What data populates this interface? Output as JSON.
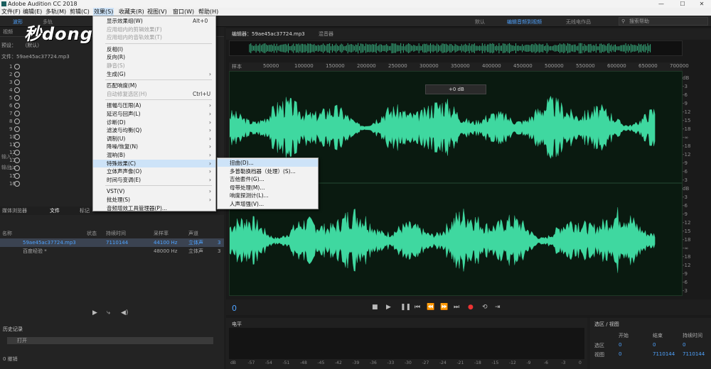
{
  "window": {
    "title": "Adobe Audition CC 2018"
  },
  "menus": {
    "file": "文件(F)",
    "edit": "编辑(E)",
    "multitrack": "多轨(M)",
    "clip": "剪辑(C)",
    "effects": "效果(S)",
    "favorites": "收藏夹(R)",
    "view": "视图(V)",
    "window": "窗口(W)",
    "help": "帮助(H)"
  },
  "workspaces": {
    "default": "默认",
    "edit_audio": "编辑音频到视频",
    "radio": "无线电作品"
  },
  "search": {
    "placeholder": "搜索帮助"
  },
  "logo": {
    "text": "秒dong视频"
  },
  "left": {
    "tabs": {
      "waveform": "波形",
      "multitrack": "多轨"
    },
    "video_tab": "视频",
    "preset_label": "预设：",
    "preset_value": "（默认）",
    "file_name": "文件：59ae45ac37724.mp3",
    "rows": [
      "1",
      "2",
      "3",
      "4",
      "5",
      "6",
      "7",
      "8",
      "9",
      "10",
      "11",
      "12",
      "13",
      "14",
      "15",
      "16"
    ],
    "input_label": "输入：",
    "output_label": "输出："
  },
  "files": {
    "tabs": {
      "media_browser": "媒体浏览器",
      "files": "文件",
      "markers": "标记"
    },
    "headers": {
      "name": "名称",
      "status": "状态",
      "duration": "持续时间",
      "sample_rate": "采样率",
      "channels": "声道"
    },
    "rows": [
      {
        "name": "59ae45ac37724.mp3",
        "duration": "7110144",
        "rate": "44100 Hz",
        "channels": "立体声",
        "extra": "3"
      },
      {
        "name": "百度经验 *",
        "duration": "",
        "rate": "48000 Hz",
        "channels": "立体声",
        "extra": "3"
      }
    ]
  },
  "history": {
    "title": "历史记录",
    "item": "打开",
    "undo_label": "0 撤销"
  },
  "editor": {
    "tab_label": "编辑器：59ae45ac37724.mp3",
    "mixer_label": "混音器",
    "hud": "+0 dB",
    "time": "0",
    "timeline": [
      "样本",
      "50000",
      "100000",
      "150000",
      "200000",
      "250000",
      "300000",
      "350000",
      "400000",
      "450000",
      "500000",
      "550000",
      "600000",
      "650000",
      "700000"
    ],
    "db_top": [
      "dB",
      "-3",
      "-6",
      "-9",
      "-12",
      "-15",
      "-18",
      "-∞",
      "-18",
      "-12",
      "-9",
      "-6",
      "-3"
    ],
    "db_bottom": [
      "dB",
      "-3",
      "-6",
      "-9",
      "-12",
      "-15",
      "-18",
      "-∞",
      "-18",
      "-12",
      "-9",
      "-6",
      "-3"
    ]
  },
  "level": {
    "title": "电平",
    "scale": [
      "dB",
      "-57",
      "-54",
      "-51",
      "-48",
      "-45",
      "-42",
      "-39",
      "-36",
      "-33",
      "-30",
      "-27",
      "-24",
      "-21",
      "-18",
      "-15",
      "-12",
      "-9",
      "-6",
      "-3",
      "0"
    ]
  },
  "selection": {
    "title": "选区 / 视图",
    "start": "开始",
    "end": "结束",
    "duration": "持续时间",
    "sel_label": "选区",
    "view_label": "视图",
    "sel_start": "0",
    "sel_end": "0",
    "sel_dur": "0",
    "view_start": "0",
    "view_end": "7110144",
    "view_dur": "7110144"
  },
  "effects_menu": {
    "items": [
      {
        "label": "显示效果组(W)",
        "shortcut": "Alt+0",
        "disabled": false
      },
      {
        "label": "应用组内的剪辑效果(F)",
        "shortcut": "",
        "disabled": true
      },
      {
        "label": "应用组内的音轨效果(T)",
        "shortcut": "",
        "disabled": true
      },
      {
        "label": "反相(I)",
        "shortcut": "",
        "disabled": false
      },
      {
        "label": "反向(R)",
        "shortcut": "",
        "disabled": false
      },
      {
        "label": "静音(S)",
        "shortcut": "",
        "disabled": true
      },
      {
        "label": "生成(G)",
        "shortcut": "",
        "disabled": false,
        "sub": true
      },
      {
        "label": "匹配响度(M)",
        "shortcut": "",
        "disabled": false
      },
      {
        "label": "自动修复选区(H)",
        "shortcut": "Ctrl+U",
        "disabled": true
      },
      {
        "label": "振幅与压限(A)",
        "sub": true
      },
      {
        "label": "延迟与回声(L)",
        "sub": true
      },
      {
        "label": "诊断(D)",
        "sub": true
      },
      {
        "label": "滤波与均衡(Q)",
        "sub": true
      },
      {
        "label": "调制(U)",
        "sub": true
      },
      {
        "label": "降噪/恢复(N)",
        "sub": true
      },
      {
        "label": "混响(B)",
        "sub": true
      },
      {
        "label": "特殊效果(C)",
        "sub": true
      },
      {
        "label": "立体声声像(O)",
        "sub": true
      },
      {
        "label": "时间与变调(E)",
        "sub": true
      },
      {
        "label": "VST(V)",
        "sub": true
      },
      {
        "label": "批处理(S)",
        "sub": true
      },
      {
        "label": "音频增效工具管理器(P)...",
        "sub": false
      }
    ]
  },
  "special_submenu": {
    "items": [
      "扭曲(D)...",
      "多普勒换档器（处理）(S)...",
      "吉他套件(G)...",
      "母带处理(M)...",
      "响度探测计(L)...",
      "人声增强(V)..."
    ]
  }
}
